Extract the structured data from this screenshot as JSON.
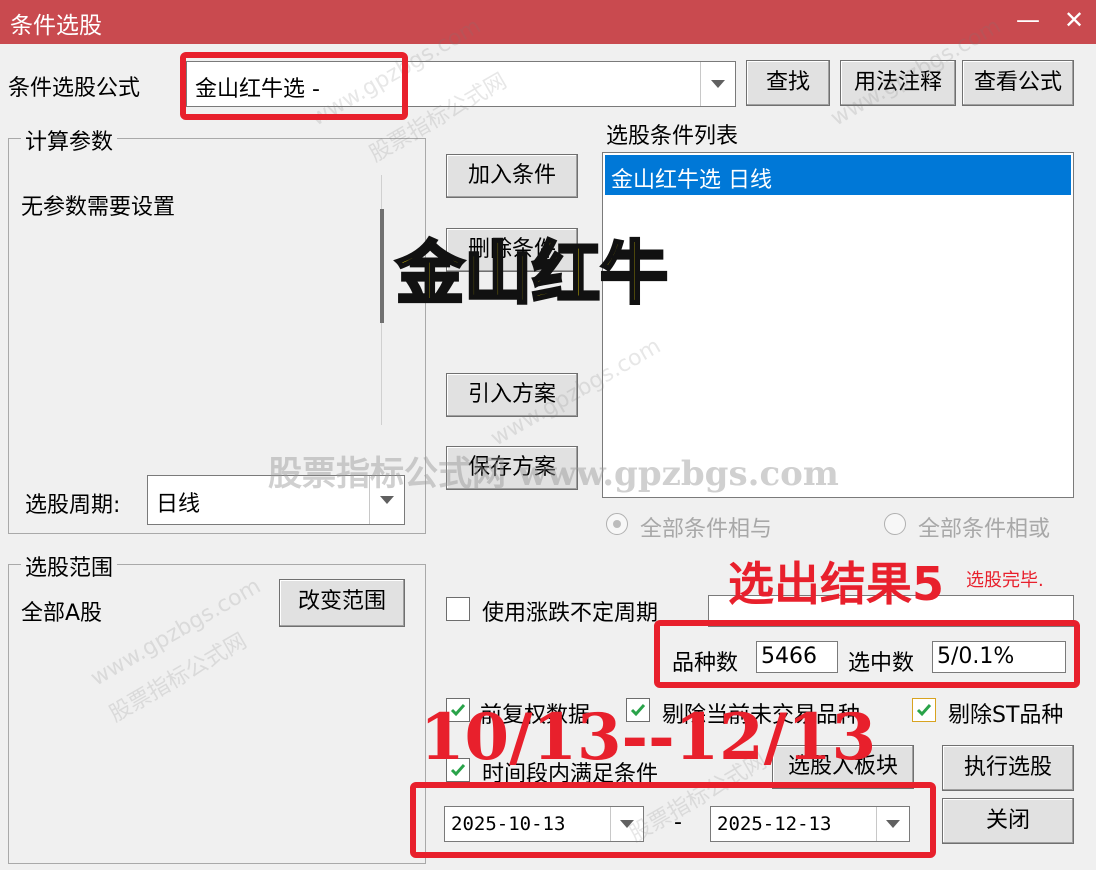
{
  "window": {
    "title": "条件选股",
    "minimize_glyph": "—",
    "close_glyph": "✕"
  },
  "formula": {
    "label": "条件选股公式",
    "value": "金山红牛选  -",
    "find_label": "查找",
    "usage_label": "用法注释",
    "view_label": "查看公式"
  },
  "params": {
    "legend": "计算参数",
    "empty_text": "无参数需要设置"
  },
  "period": {
    "label": "选股周期:",
    "value": "日线"
  },
  "buttons": {
    "add": "加入条件",
    "delete": "删除条件",
    "import": "引入方案",
    "save": "保存方案",
    "change_range": "改变范围",
    "to_block": "选股入板块",
    "execute": "执行选股",
    "close": "关闭"
  },
  "conditions": {
    "title": "选股条件列表",
    "items": [
      "金山红牛选  日线"
    ]
  },
  "logic": {
    "and_label": "全部条件相与",
    "or_label": "全部条件相或"
  },
  "range": {
    "legend": "选股范围",
    "value": "全部A股"
  },
  "options": {
    "variable_period": "使用涨跌不定周期",
    "forward_adjust": "前复权数据",
    "exclude_untraded": "剔除当前未交易品种",
    "exclude_st": "剔除ST品种",
    "time_range": "时间段内满足条件"
  },
  "stats": {
    "count_label": "品种数",
    "count_value": "5466",
    "selected_label": "选中数",
    "selected_value": "5/0.1%",
    "status_text": "选股完毕."
  },
  "dates": {
    "start": "2025-10-13",
    "separator": "-",
    "end": "2025-12-13"
  },
  "annotations": {
    "title_overlay": "金山红牛",
    "result_overlay": "选出结果5",
    "date_overlay": "10/13--12/13",
    "watermark_center": "股票指标公式网 www.gpzbgs.com",
    "watermark_domain": "www.gpzbgs.com",
    "watermark_cn": "股票指标公式网"
  },
  "colors": {
    "titlebar": "#c94a4f",
    "selection": "#0078d7",
    "check": "#2aa34a",
    "annotation_red": "#e8202c",
    "annotation_yellow": "#ffe600"
  }
}
